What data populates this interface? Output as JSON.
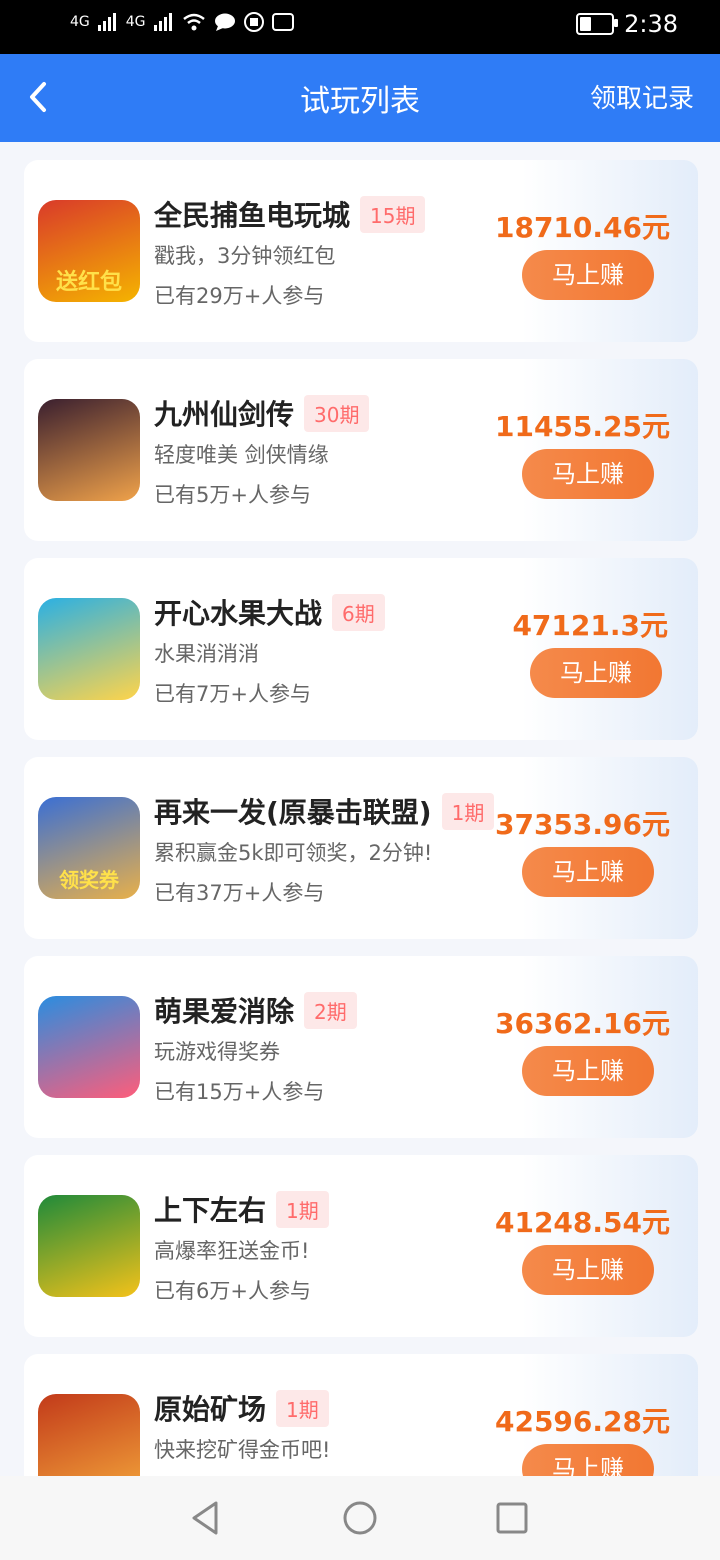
{
  "status_bar": {
    "signal1": "4G",
    "signal2": "4G",
    "time": "2:38"
  },
  "header": {
    "title": "试玩列表",
    "record_label": "领取记录"
  },
  "games": [
    {
      "name": "全民捕鱼电玩城",
      "period": "15期",
      "desc": "戳我，3分钟领红包",
      "people": "已有29万+人参与",
      "amount": "18710.46元",
      "button": "马上赚",
      "icon_label": "送红包",
      "icon_bg1": "#d93a2a",
      "icon_bg2": "#f5b400"
    },
    {
      "name": "九州仙剑传",
      "period": "30期",
      "desc": "轻度唯美 剑侠情缘",
      "people": "已有5万+人参与",
      "amount": "11455.25元",
      "button": "马上赚",
      "icon_label": "",
      "icon_bg1": "#3a1f2f",
      "icon_bg2": "#f0a24a"
    },
    {
      "name": "开心水果大战",
      "period": "6期",
      "desc": "水果消消消",
      "people": "已有7万+人参与",
      "amount": "47121.3元",
      "button": "马上赚",
      "icon_label": "",
      "icon_bg1": "#2ab0e4",
      "icon_bg2": "#ffd44a"
    },
    {
      "name": "再来一发(原暴击联盟)",
      "period": "1期",
      "desc": "累积赢金5k即可领奖，2分钟!",
      "people": "已有37万+人参与",
      "amount": "37353.96元",
      "button": "马上赚",
      "icon_label": "领奖券",
      "icon_bg1": "#3a6fd4",
      "icon_bg2": "#e8b04a"
    },
    {
      "name": "萌果爱消除",
      "period": "2期",
      "desc": "玩游戏得奖券",
      "people": "已有15万+人参与",
      "amount": "36362.16元",
      "button": "马上赚",
      "icon_label": "",
      "icon_bg1": "#2a8de0",
      "icon_bg2": "#ff5d7a"
    },
    {
      "name": "上下左右",
      "period": "1期",
      "desc": "高爆率狂送金币!",
      "people": "已有6万+人参与",
      "amount": "41248.54元",
      "button": "马上赚",
      "icon_label": "",
      "icon_bg1": "#1f8a3a",
      "icon_bg2": "#f4c21a"
    },
    {
      "name": "原始矿场",
      "period": "1期",
      "desc": "快来挖矿得金币吧!",
      "people": "",
      "amount": "42596.28元",
      "button": "马上赚",
      "icon_label": "",
      "icon_bg1": "#c23a1a",
      "icon_bg2": "#f2a33a"
    }
  ]
}
